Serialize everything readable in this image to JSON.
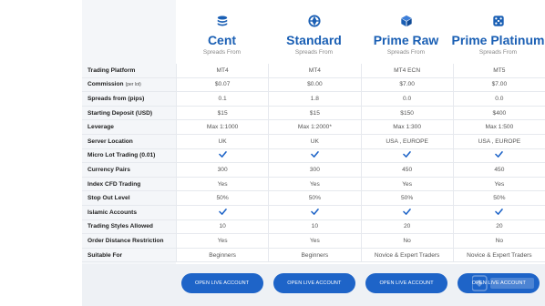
{
  "plans": [
    {
      "name": "Cent",
      "subtitle": "Spreads From",
      "icon": "coins-icon"
    },
    {
      "name": "Standard",
      "subtitle": "Spreads From",
      "icon": "globe-icon"
    },
    {
      "name": "Prime Raw",
      "subtitle": "Spreads From",
      "icon": "cube-icon"
    },
    {
      "name": "Prime Platinum",
      "subtitle": "Spreads From",
      "icon": "dice-icon"
    }
  ],
  "rows": [
    {
      "label": "Trading Platform",
      "values": [
        "MT4",
        "MT4",
        "MT4 ECN",
        "MT5"
      ]
    },
    {
      "label": "Commission",
      "label_note": "(per lot)",
      "values": [
        "$0.07",
        "$0.00",
        "$7.00",
        "$7.00"
      ]
    },
    {
      "label": "Spreads from (pips)",
      "values": [
        "0.1",
        "1.8",
        "0.0",
        "0.0"
      ]
    },
    {
      "label": "Starting Deposit (USD)",
      "values": [
        "$15",
        "$15",
        "$150",
        "$400"
      ]
    },
    {
      "label": "Leverage",
      "values": [
        "Max 1:1000",
        "Max 1:2000*",
        "Max 1:300",
        "Max 1:500"
      ]
    },
    {
      "label": "Server Location",
      "values": [
        "UK",
        "UK",
        "USA , EUROPE",
        "USA , EUROPE"
      ]
    },
    {
      "label": "Micro Lot Trading (0.01)",
      "values": [
        "check",
        "check",
        "check",
        "check"
      ]
    },
    {
      "label": "Currency Pairs",
      "values": [
        "300",
        "300",
        "450",
        "450"
      ]
    },
    {
      "label": "Index CFD Trading",
      "values": [
        "Yes",
        "Yes",
        "Yes",
        "Yes"
      ]
    },
    {
      "label": "Stop Out Level",
      "values": [
        "50%",
        "50%",
        "50%",
        "50%"
      ]
    },
    {
      "label": "Islamic Accounts",
      "values": [
        "check",
        "check",
        "check",
        "check"
      ]
    },
    {
      "label": "Trading Styles Allowed",
      "values": [
        "10",
        "10",
        "20",
        "20"
      ]
    },
    {
      "label": "Order Distance Restriction",
      "values": [
        "Yes",
        "Yes",
        "No",
        "No"
      ]
    },
    {
      "label": "Suitable For",
      "values": [
        "Beginners",
        "Beginners",
        "Novice & Expert Traders",
        "Novice & Expert Traders"
      ]
    }
  ],
  "buttons": {
    "open_live_label": "OPEN LIVE ACCOUNT"
  },
  "colors": {
    "accent": "#1e64c8",
    "heading": "#1a5fb4"
  }
}
